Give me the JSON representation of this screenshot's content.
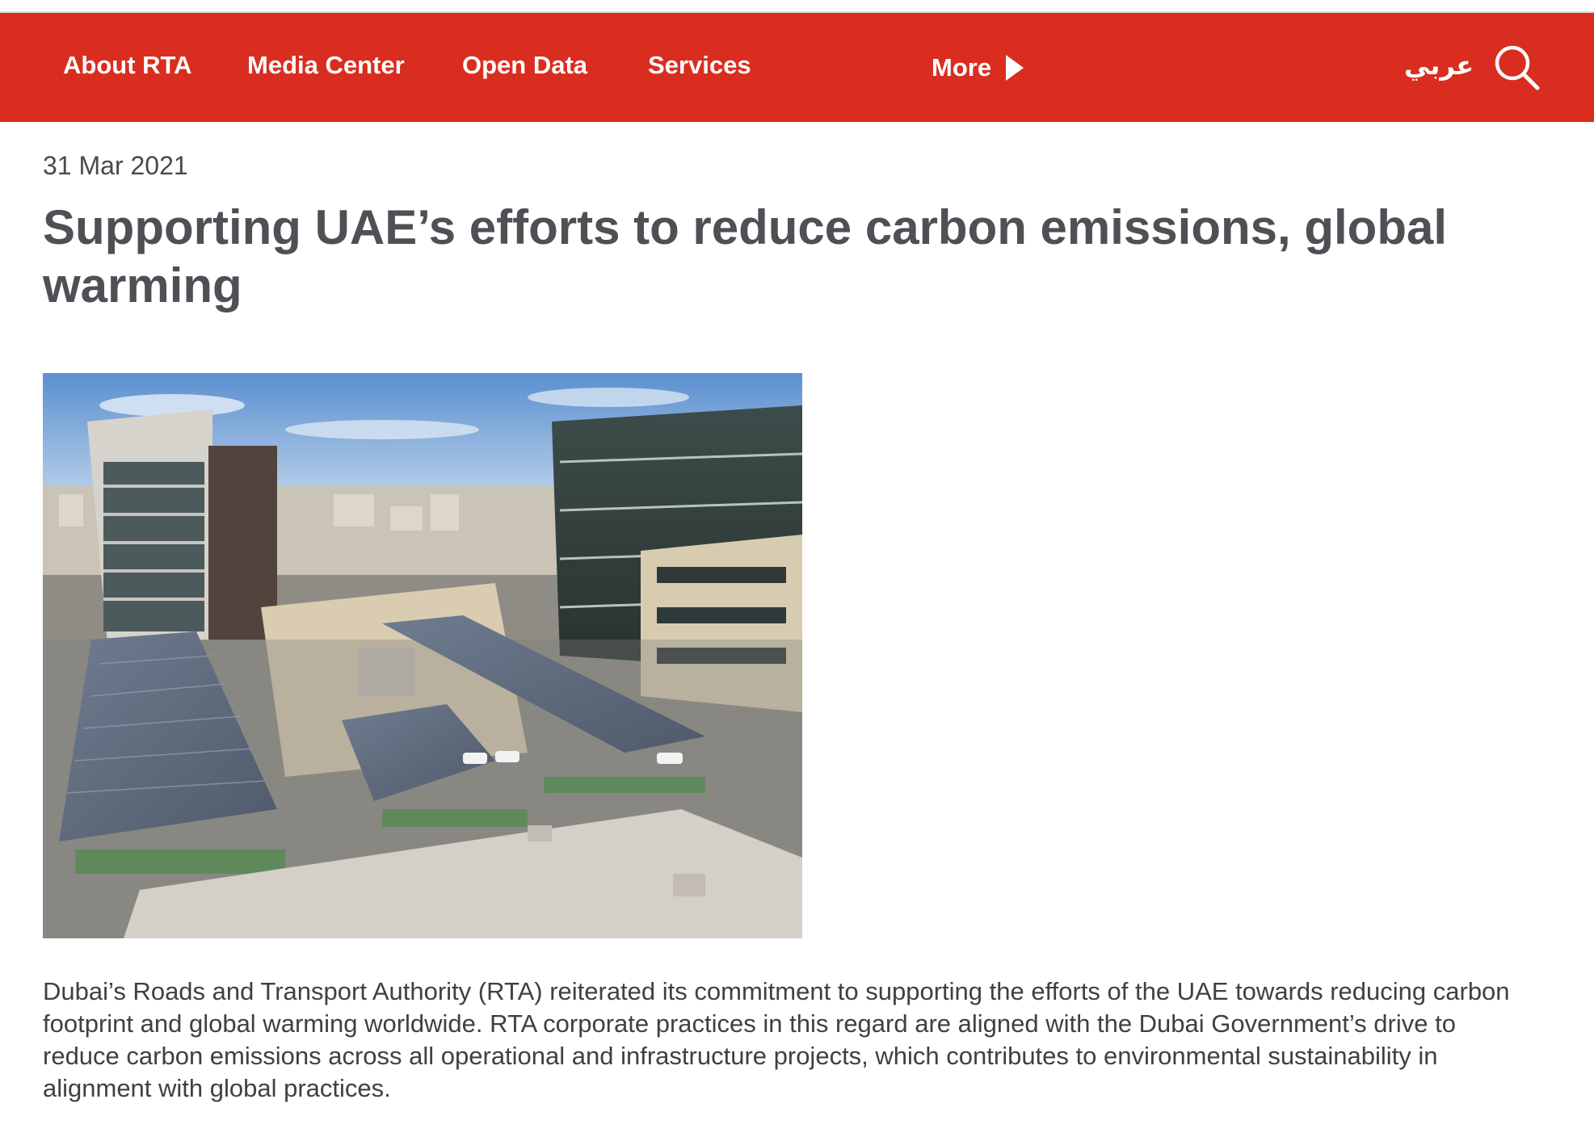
{
  "nav": {
    "items": [
      {
        "label": "About RTA"
      },
      {
        "label": "Media Center"
      },
      {
        "label": "Open Data"
      },
      {
        "label": "Services"
      }
    ],
    "more_label": "More",
    "language_label": "عربي",
    "search_icon": "search-icon"
  },
  "article": {
    "date": "31 Mar 2021",
    "title": "Supporting UAE’s efforts to reduce carbon emissions, global warming",
    "image_description_icon": "photo-solar-carports",
    "body": "Dubai’s Roads and Transport Authority (RTA) reiterated its commitment to supporting the efforts of the UAE towards reducing carbon footprint and global warming worldwide. RTA corporate practices in this regard are aligned with the Dubai Government’s drive to reduce carbon emissions across all operational and infrastructure projects, which contributes to environmental sustainability in alignment with global practices."
  },
  "colors": {
    "brand_red": "#d92d20",
    "title_text": "#4f4f55",
    "body_text": "#3f3f44"
  }
}
